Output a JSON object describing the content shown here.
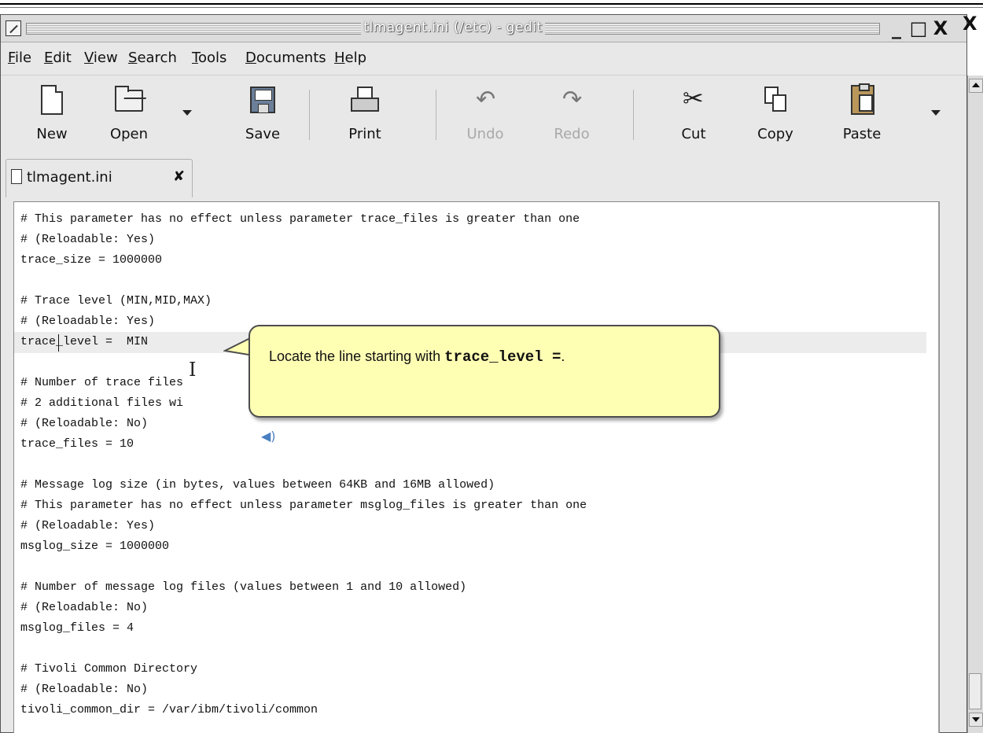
{
  "window": {
    "title": "tlmagent.ini (/etc) - gedit",
    "controls": {
      "minimize": "_",
      "maximize": "□",
      "close": "X",
      "outer_close": "X"
    }
  },
  "menu": {
    "items": [
      {
        "label_mnemonic": "F",
        "label_rest": "ile"
      },
      {
        "label_mnemonic": "E",
        "label_rest": "dit"
      },
      {
        "label_mnemonic": "V",
        "label_rest": "iew"
      },
      {
        "label_mnemonic": "S",
        "label_rest": "earch"
      },
      {
        "label_mnemonic": "T",
        "label_rest": "ools"
      },
      {
        "label_mnemonic": "D",
        "label_rest": "ocuments"
      },
      {
        "label_mnemonic": "H",
        "label_rest": "elp"
      }
    ]
  },
  "toolbar": {
    "new_label": "New",
    "open_label": "Open",
    "save_label": "Save",
    "print_label": "Print",
    "undo_label": "Undo",
    "redo_label": "Redo",
    "cut_label": "Cut",
    "copy_label": "Copy",
    "paste_label": "Paste",
    "icons": {
      "new": "new-document-icon",
      "open": "folder-open-icon",
      "save": "floppy-disk-icon",
      "print": "printer-icon",
      "undo": "undo-arrow-icon",
      "redo": "redo-arrow-icon",
      "cut": "scissors-icon",
      "copy": "copy-pages-icon",
      "paste": "clipboard-icon"
    }
  },
  "tab": {
    "label": "tlmagent.ini",
    "close": "✘"
  },
  "editor": {
    "lines": [
      "# This parameter has no effect unless parameter trace_files is greater than one",
      "# (Reloadable: Yes)",
      "trace_size = 1000000",
      "",
      "# Trace level (MIN,MID,MAX)",
      "# (Reloadable: Yes)",
      "trace_level =  MIN",
      "",
      "# Number of trace files",
      "# 2 additional files wi",
      "# (Reloadable: No)",
      "trace_files = 10",
      "",
      "# Message log size (in bytes, values between 64KB and 16MB allowed)",
      "# This parameter has no effect unless parameter msglog_files is greater than one",
      "# (Reloadable: Yes)",
      "msglog_size = 1000000",
      "",
      "# Number of message log files (values between 1 and 10 allowed)",
      "# (Reloadable: No)",
      "msglog_files = 4",
      "",
      "# Tivoli Common Directory",
      "# (Reloadable: No)",
      "tivoli_common_dir = /var/ibm/tivoli/common"
    ],
    "current_line_index": 6
  },
  "callout": {
    "text_before": "Locate  the line starting with ",
    "code": "trace_level =",
    "text_after": "."
  },
  "colors": {
    "callout_bg": "#ffffb4",
    "window_bg": "#e8e8e8",
    "editor_bg": "#ffffff",
    "current_line_bg": "#ececec"
  }
}
